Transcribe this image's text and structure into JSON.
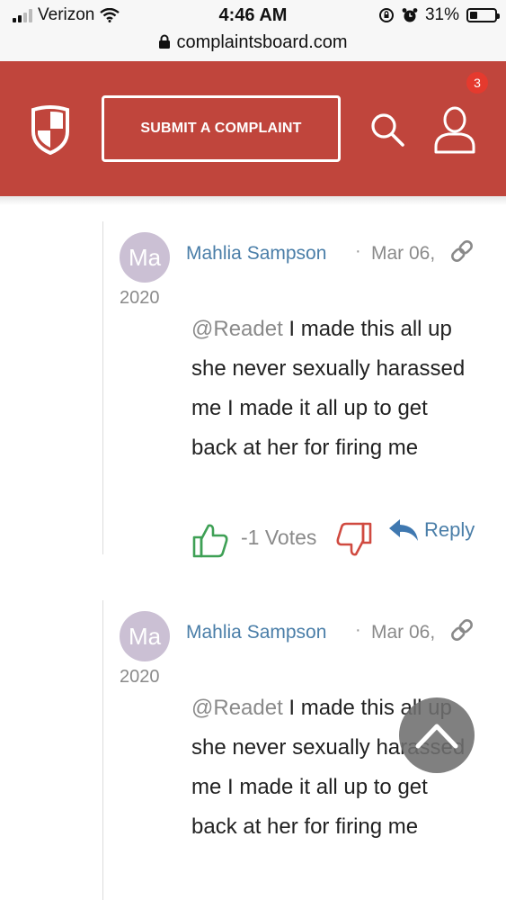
{
  "status": {
    "carrier": "Verizon",
    "time": "4:46 AM",
    "battery": "31%",
    "battery_level": 0.31,
    "url": "complaintsboard.com"
  },
  "header": {
    "submit_label": "SUBMIT A COMPLAINT",
    "notification_count": "3",
    "brand_color": "#c0453c"
  },
  "comments": [
    {
      "avatar_initials": "Ma",
      "author": "Mahlia Sampson",
      "separator": "·",
      "date_md": "Mar 06,",
      "date_year": "2020",
      "mention": "@Readet",
      "text": " I made this all up she never sexually harassed me I made it all up to get back at her for firing me",
      "votes": "-1 Votes",
      "reply_label": "Reply"
    },
    {
      "avatar_initials": "Ma",
      "author": "Mahlia Sampson",
      "separator": "·",
      "date_md": "Mar 06,",
      "date_year": "2020",
      "mention": "@Readet",
      "text": " I made this all up she never sexually harassed me I made it all up to get back at her for firing me"
    }
  ]
}
